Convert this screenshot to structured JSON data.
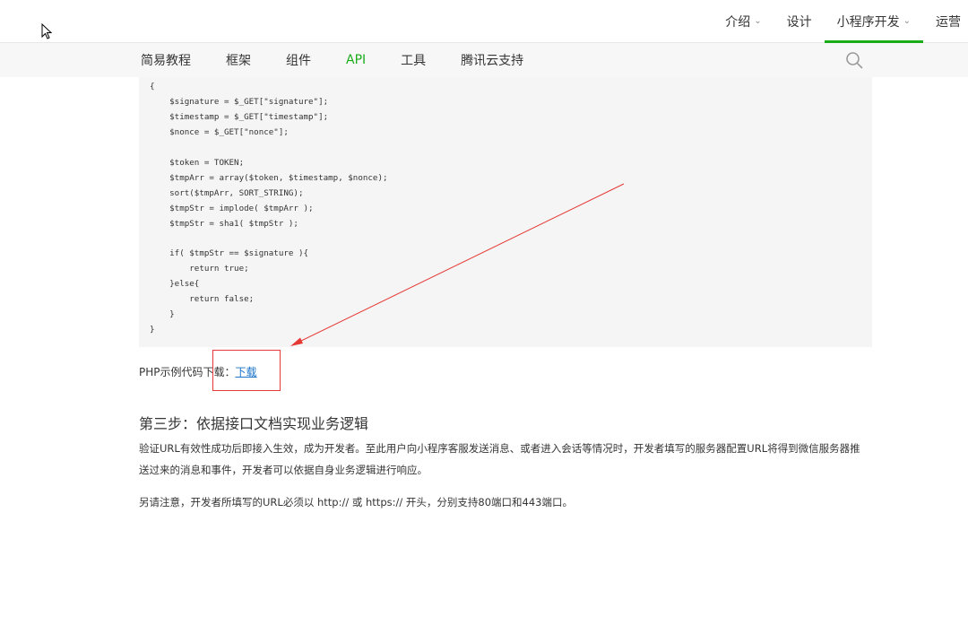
{
  "topnav": {
    "items": [
      {
        "label": "介绍",
        "dropdown": true
      },
      {
        "label": "设计",
        "dropdown": false
      },
      {
        "label": "小程序开发",
        "dropdown": true,
        "active": true
      },
      {
        "label": "运营",
        "dropdown": false
      }
    ],
    "chevron": "⌄"
  },
  "subnav": {
    "items": [
      "简易教程",
      "框架",
      "组件",
      "API",
      "工具",
      "腾讯云支持"
    ],
    "active": "API"
  },
  "code": {
    "lines": [
      "{",
      "    $signature = $_GET[\"signature\"];",
      "    $timestamp = $_GET[\"timestamp\"];",
      "    $nonce = $_GET[\"nonce\"];",
      "",
      "    $token = TOKEN;",
      "    $tmpArr = array($token, $timestamp, $nonce);",
      "    sort($tmpArr, SORT_STRING);",
      "    $tmpStr = implode( $tmpArr );",
      "    $tmpStr = sha1( $tmpStr );",
      "",
      "    if( $tmpStr == $signature ){",
      "        return true;",
      "    }else{",
      "        return false;",
      "    }",
      "}"
    ]
  },
  "content": {
    "download_label": "PHP示例代码下载：",
    "download_link": "下载",
    "step3_title": "第三步：依据接口文档实现业务逻辑",
    "para1": "验证URL有效性成功后即接入生效，成为开发者。至此用户向小程序客服发送消息、或者进入会话等情况时，开发者填写的服务器配置URL将得到微信服务器推送过来的消息和事件，开发者可以依据自身业务逻辑进行响应。",
    "para2": "另请注意，开发者所填写的URL必须以 http:// 或 https:// 开头，分别支持80端口和443端口。"
  },
  "colors": {
    "accent": "#1aad19",
    "link": "#1a73c8",
    "annotation": "#e53935"
  },
  "icons": {
    "search": "search-icon",
    "cursor": "mouse-cursor-icon"
  }
}
